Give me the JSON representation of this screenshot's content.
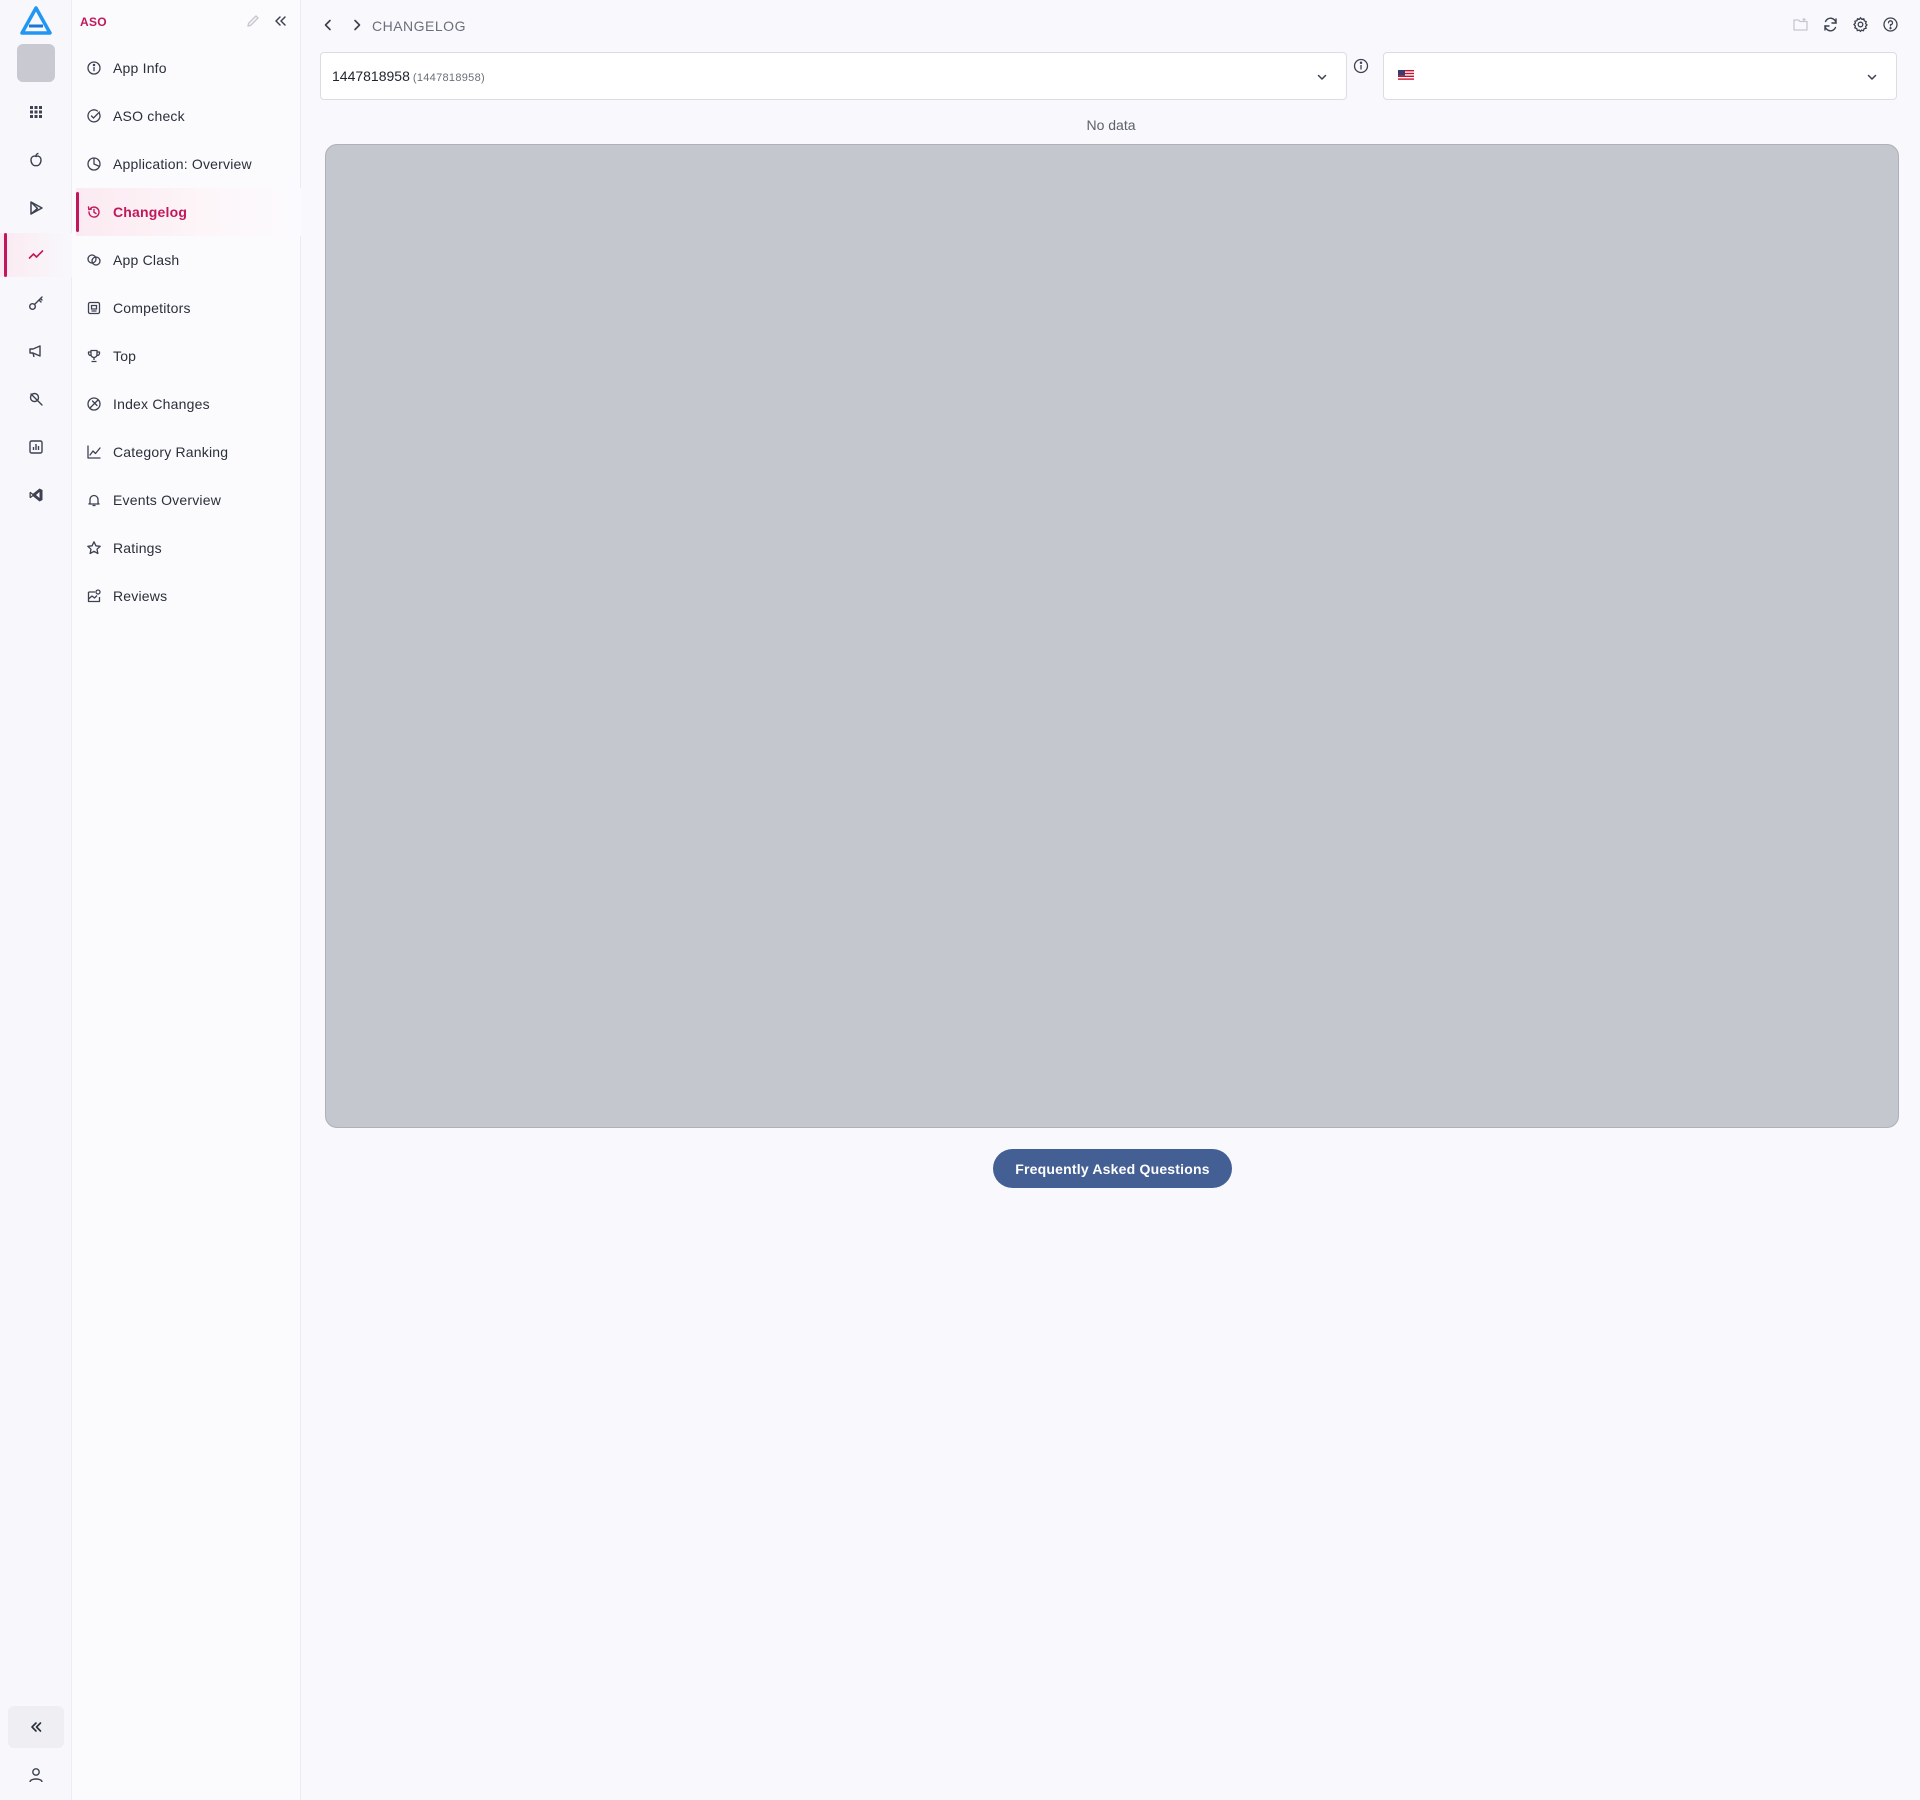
{
  "brand": {
    "accent": "#c2185b",
    "faq_button_color": "#445f93",
    "logo_color": "#2196f3"
  },
  "rail": {
    "items": [
      {
        "icon": "grid-icon"
      },
      {
        "icon": "apple-icon"
      },
      {
        "icon": "play-store-icon"
      },
      {
        "icon": "trend-icon",
        "active": true
      },
      {
        "icon": "key-icon"
      },
      {
        "icon": "megaphone-icon"
      },
      {
        "icon": "search-tools-icon"
      },
      {
        "icon": "report-icon"
      },
      {
        "icon": "vscode-icon"
      }
    ]
  },
  "sidebar": {
    "title": "ASO",
    "items": [
      {
        "label": "App Info",
        "icon": "info-circle-icon"
      },
      {
        "label": "ASO check",
        "icon": "check-circle-icon"
      },
      {
        "label": "Application: Overview",
        "icon": "pie-chart-icon"
      },
      {
        "label": "Changelog",
        "icon": "history-icon",
        "active": true
      },
      {
        "label": "App Clash",
        "icon": "clash-icon"
      },
      {
        "label": "Competitors",
        "icon": "competitors-icon"
      },
      {
        "label": "Top",
        "icon": "trophy-icon"
      },
      {
        "label": "Index Changes",
        "icon": "index-icon"
      },
      {
        "label": "Category Ranking",
        "icon": "line-chart-icon"
      },
      {
        "label": "Events Overview",
        "icon": "bell-icon"
      },
      {
        "label": "Ratings",
        "icon": "star-icon"
      },
      {
        "label": "Reviews",
        "icon": "reviews-icon"
      }
    ]
  },
  "header": {
    "breadcrumb": "CHANGELOG"
  },
  "filters": {
    "app_value": "1447818958",
    "app_sub": "(1447818958)",
    "country_flag": "us-flag-icon"
  },
  "main": {
    "empty_text": "No data",
    "faq_label": "Frequently Asked Questions"
  }
}
